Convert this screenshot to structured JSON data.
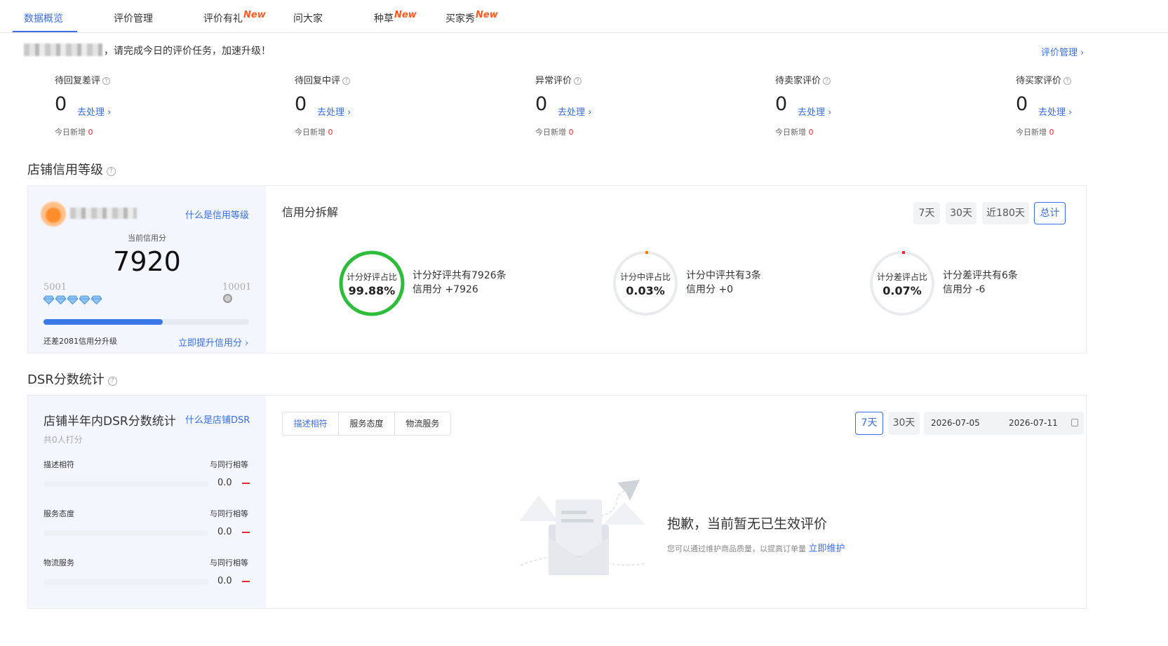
{
  "tabs": [
    {
      "label": "数据概览",
      "new": ""
    },
    {
      "label": "评价管理",
      "new": ""
    },
    {
      "label": "评价有礼",
      "new": "New"
    },
    {
      "label": "问大家",
      "new": ""
    },
    {
      "label": "种草",
      "new": "New"
    },
    {
      "label": "买家秀",
      "new": "New"
    }
  ],
  "greeting": {
    "text": "，请完成今日的评价任务，加速升级！",
    "link": "评价管理 ›"
  },
  "stats": [
    {
      "label": "待回复差评",
      "value": "0",
      "link": "去处理 ›",
      "new_label": "今日新增",
      "new_value": "0"
    },
    {
      "label": "待回复中评",
      "value": "0",
      "link": "去处理 ›",
      "new_label": "今日新增",
      "new_value": "0"
    },
    {
      "label": "异常评价",
      "value": "0",
      "link": "去处理 ›",
      "new_label": "今日新增",
      "new_value": "0"
    },
    {
      "label": "待卖家评价",
      "value": "0",
      "link": "去处理 ›",
      "new_label": "今日新增",
      "new_value": "0"
    },
    {
      "label": "待买家评价",
      "value": "0",
      "link": "去处理 ›",
      "new_label": "今日新增",
      "new_value": "0"
    }
  ],
  "credit": {
    "section_title": "店铺信用等级",
    "what_link": "什么是信用等级",
    "current_label": "当前信用分",
    "score": "7920",
    "min": "5001",
    "max": "10001",
    "diamonds": 5,
    "progress": 0.58,
    "upgrade_text": "还差2081信用分升级",
    "upgrade_link": "立即提升信用分 ›"
  },
  "breakdown": {
    "title": "信用分拆解",
    "ranges": [
      "7天",
      "30天",
      "近180天",
      "总计"
    ],
    "active_range": 3,
    "rings": [
      {
        "label": "计分好评占比",
        "value": "99.88%",
        "ratio": 0.9988,
        "color": "#2ebd3a",
        "desc1": "计分好评共有7926条",
        "desc2": "信用分 +7926"
      },
      {
        "label": "计分中评占比",
        "value": "0.03%",
        "ratio": 0.0003,
        "color": "#ff7a00",
        "desc1": "计分中评共有3条",
        "desc2": "信用分 +0"
      },
      {
        "label": "计分差评占比",
        "value": "0.07%",
        "ratio": 0.0007,
        "color": "#f5222d",
        "desc1": "计分差评共有6条",
        "desc2": "信用分 -6"
      }
    ]
  },
  "dsr": {
    "section_title": "DSR分数统计",
    "card_title": "店铺半年内DSR分数统计",
    "what_link": "什么是店铺DSR",
    "raters": "共0人打分",
    "items": [
      {
        "label": "描述相符",
        "compare": "与同行相等",
        "score": "0.0",
        "ratio": 0
      },
      {
        "label": "服务态度",
        "compare": "与同行相等",
        "score": "0.0",
        "ratio": 0
      },
      {
        "label": "物流服务",
        "compare": "与同行相等",
        "score": "0.0",
        "ratio": 0
      }
    ],
    "tabs": [
      "描述相符",
      "服务态度",
      "物流服务"
    ],
    "ranges": [
      "7天",
      "30天"
    ],
    "date_start": "2026-07-05",
    "date_end": "2026-07-11",
    "empty_title": "抱歉，当前暂无已生效评价",
    "empty_desc": "您可以通过维护商品质量，以提高订单量",
    "empty_link": "立即维护"
  },
  "colors": {
    "accent": "#3a6ee8",
    "alert": "#f5222d",
    "good": "#2ebd3a",
    "mid": "#ff7a00"
  }
}
